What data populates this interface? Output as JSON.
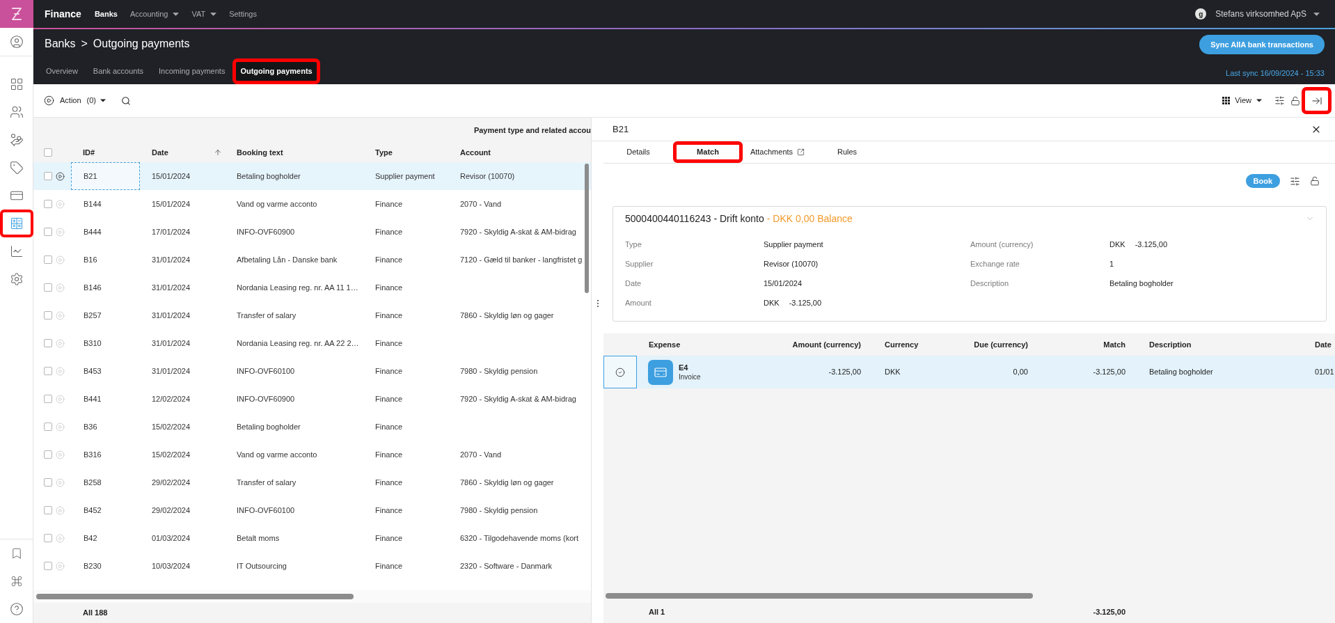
{
  "topbar": {
    "app_title": "Finance",
    "nav": [
      {
        "label": "Banks",
        "selected": true,
        "dropdown": false
      },
      {
        "label": "Accounting",
        "selected": false,
        "dropdown": true
      },
      {
        "label": "VAT",
        "selected": false,
        "dropdown": true
      },
      {
        "label": "Settings",
        "selected": false,
        "dropdown": false
      }
    ],
    "avatar": "g",
    "company": "Stefans virksomhed ApS"
  },
  "sidebar": {
    "items": [
      {
        "selected": false,
        "highlighted": false
      },
      {
        "selected": false,
        "highlighted": false
      },
      {
        "selected": false,
        "highlighted": false
      },
      {
        "selected": false,
        "highlighted": false
      },
      {
        "selected": false,
        "highlighted": false
      },
      {
        "selected": true,
        "highlighted": true
      },
      {
        "selected": false,
        "highlighted": false
      },
      {
        "selected": false,
        "highlighted": false
      }
    ]
  },
  "header": {
    "breadcrumb": [
      "Banks",
      "Outgoing payments"
    ],
    "separator": ">",
    "sync_button": "Sync AIIA bank transactions",
    "last_sync": "Last sync 16/09/2024 - 15:33",
    "tabs": [
      {
        "label": "Overview",
        "selected": false,
        "highlighted": false
      },
      {
        "label": "Bank accounts",
        "selected": false,
        "highlighted": false
      },
      {
        "label": "Incoming payments",
        "selected": false,
        "highlighted": false
      },
      {
        "label": "Outgoing payments",
        "selected": true,
        "highlighted": true
      }
    ]
  },
  "toolbar": {
    "action": "Action",
    "action_count": "(0)",
    "view": "View",
    "collapse_highlighted": true
  },
  "payments": {
    "group_header": "Payment type and related accou",
    "select_all_checked": false,
    "columns": [
      {
        "label": "ID#",
        "sorted": false
      },
      {
        "label": "Date",
        "sorted": true
      },
      {
        "label": "Booking text",
        "sorted": false
      },
      {
        "label": "Type",
        "sorted": false
      },
      {
        "label": "Account",
        "sorted": false
      }
    ],
    "rows": [
      {
        "id": "B21",
        "date": "15/01/2024",
        "booking_text": "Betaling bogholder",
        "type": "Supplier payment",
        "account": "Revisor (10070)",
        "selected": true,
        "checked": false,
        "focused": true
      },
      {
        "id": "B144",
        "date": "15/01/2024",
        "booking_text": "Vand og varme acconto",
        "type": "Finance",
        "account": "2070 - Vand",
        "selected": false,
        "checked": false,
        "focused": false
      },
      {
        "id": "B444",
        "date": "17/01/2024",
        "booking_text": "INFO-OVF60900",
        "type": "Finance",
        "account": "7920 - Skyldig A-skat & AM-bidrag",
        "selected": false,
        "checked": false,
        "focused": false
      },
      {
        "id": "B16",
        "date": "31/01/2024",
        "booking_text": "Afbetaling Lån - Danske bank",
        "type": "Finance",
        "account": "7120 - Gæld til banker - langfristet g",
        "selected": false,
        "checked": false,
        "focused": false
      },
      {
        "id": "B146",
        "date": "31/01/2024",
        "booking_text": "Nordania Leasing reg. nr. AA 11 1…",
        "type": "Finance",
        "selected": false,
        "checked": false,
        "focused": false
      },
      {
        "id": "B257",
        "date": "31/01/2024",
        "booking_text": "Transfer of salary",
        "type": "Finance",
        "account": "7860 - Skyldig løn og gager",
        "selected": false,
        "checked": false,
        "focused": false
      },
      {
        "id": "B310",
        "date": "31/01/2024",
        "booking_text": "Nordania Leasing reg. nr. AA 22 2…",
        "type": "Finance",
        "selected": false,
        "checked": false,
        "focused": false
      },
      {
        "id": "B453",
        "date": "31/01/2024",
        "booking_text": "INFO-OVF60100",
        "type": "Finance",
        "account": "7980 - Skyldig pension",
        "selected": false,
        "checked": false,
        "focused": false
      },
      {
        "id": "B441",
        "date": "12/02/2024",
        "booking_text": "INFO-OVF60900",
        "type": "Finance",
        "account": "7920 - Skyldig A-skat & AM-bidrag",
        "selected": false,
        "checked": false,
        "focused": false
      },
      {
        "id": "B36",
        "date": "15/02/2024",
        "booking_text": "Betaling bogholder",
        "type": "Finance",
        "selected": false,
        "checked": false,
        "focused": false
      },
      {
        "id": "B316",
        "date": "15/02/2024",
        "booking_text": "Vand og varme acconto",
        "type": "Finance",
        "account": "2070 - Vand",
        "selected": false,
        "checked": false,
        "focused": false
      },
      {
        "id": "B258",
        "date": "29/02/2024",
        "booking_text": "Transfer of salary",
        "type": "Finance",
        "account": "7860 - Skyldig løn og gager",
        "selected": false,
        "checked": false,
        "focused": false
      },
      {
        "id": "B452",
        "date": "29/02/2024",
        "booking_text": "INFO-OVF60100",
        "type": "Finance",
        "account": "7980 - Skyldig pension",
        "selected": false,
        "checked": false,
        "focused": false
      },
      {
        "id": "B42",
        "date": "01/03/2024",
        "booking_text": "Betalt moms",
        "type": "Finance",
        "account": "6320 - Tilgodehavende moms (kort",
        "selected": false,
        "checked": false,
        "focused": false
      },
      {
        "id": "B230",
        "date": "10/03/2024",
        "booking_text": "IT Outsourcing",
        "type": "Finance",
        "account": "2320 - Software - Danmark",
        "selected": false,
        "checked": false,
        "focused": false
      }
    ],
    "footer": "All 188"
  },
  "detail": {
    "title": "B21",
    "tabs": [
      {
        "label": "Details",
        "selected": false,
        "highlighted": false,
        "external": false
      },
      {
        "label": "Match",
        "selected": true,
        "highlighted": true,
        "external": false
      },
      {
        "label": "Attachments",
        "selected": false,
        "highlighted": false,
        "external": true
      },
      {
        "label": "Rules",
        "selected": false,
        "highlighted": false,
        "external": false
      }
    ],
    "book_button": "Book",
    "account": {
      "title": "5000400440116243 - Drift konto",
      "balance": "- DKK 0,00 Balance",
      "left_fields": [
        {
          "label": "Type",
          "value": "Supplier payment"
        },
        {
          "label": "Supplier",
          "value": "Revisor (10070)"
        },
        {
          "label": "Date",
          "value": "15/01/2024"
        },
        {
          "label": "Amount",
          "currency": "DKK",
          "value": "-3.125,00"
        }
      ],
      "right_fields": [
        {
          "label": "Amount (currency)",
          "currency": "DKK",
          "value": "-3.125,00"
        },
        {
          "label": "Exchange rate",
          "value": "1"
        },
        {
          "label": "Description",
          "value": "Betaling bogholder"
        }
      ]
    },
    "match_table": {
      "columns": [
        "Expense",
        "Amount (currency)",
        "Currency",
        "Due (currency)",
        "Match",
        "Description",
        "Date"
      ],
      "rows": [
        {
          "matched": true,
          "selected": true,
          "expense": "E4",
          "expense_type": "Invoice",
          "amount": "-3.125,00",
          "currency": "DKK",
          "due": "0,00",
          "match": "-3.125,00",
          "description": "Betaling bogholder",
          "date": "01/01"
        }
      ],
      "footer_count": "All 1",
      "footer_total": "-3.125,00"
    }
  }
}
